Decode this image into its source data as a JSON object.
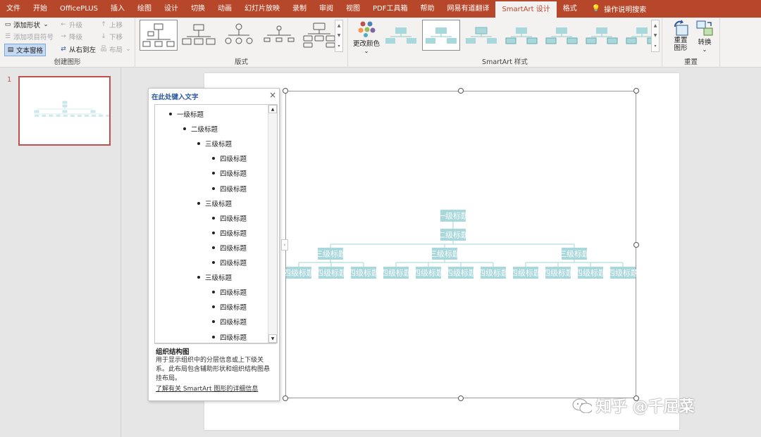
{
  "menubar": {
    "tabs": [
      "文件",
      "开始",
      "OfficePLUS",
      "插入",
      "绘图",
      "设计",
      "切换",
      "动画",
      "幻灯片放映",
      "录制",
      "审阅",
      "视图",
      "PDF工具箱",
      "帮助",
      "网易有道翻译",
      "SmartArt 设计",
      "格式"
    ],
    "active_tab": "SmartArt 设计",
    "tell_me": "操作说明搜索"
  },
  "ribbon": {
    "create_graphic": {
      "label": "创建图形",
      "add_shape": "添加形状",
      "add_bullet": "添加项目符号",
      "text_pane": "文本窗格",
      "promote": "升级",
      "demote": "降级",
      "right_to_left": "从右到左",
      "move_up": "上移",
      "move_down": "下移",
      "layout": "布局"
    },
    "layouts": {
      "label": "版式"
    },
    "styles": {
      "label": "SmartArt 样式",
      "change_colors": "更改颜色"
    },
    "reset": {
      "label": "重置",
      "reset_graphic": "重置图形",
      "convert": "转换"
    }
  },
  "thumbnails": {
    "slide_number": "1"
  },
  "text_pane": {
    "title": "在此处键入文字",
    "items": [
      {
        "level": 1,
        "text": "一级标题"
      },
      {
        "level": 2,
        "text": "二级标题"
      },
      {
        "level": 3,
        "text": "三级标题"
      },
      {
        "level": 4,
        "text": "四级标题"
      },
      {
        "level": 4,
        "text": "四级标题"
      },
      {
        "level": 4,
        "text": "四级标题"
      },
      {
        "level": 3,
        "text": "三级标题"
      },
      {
        "level": 4,
        "text": "四级标题"
      },
      {
        "level": 4,
        "text": "四级标题"
      },
      {
        "level": 4,
        "text": "四级标题"
      },
      {
        "level": 4,
        "text": "四级标题"
      },
      {
        "level": 3,
        "text": "三级标题"
      },
      {
        "level": 4,
        "text": "四级标题"
      },
      {
        "level": 4,
        "text": "四级标题"
      },
      {
        "level": 4,
        "text": "四级标题"
      },
      {
        "level": 4,
        "text": "四级标题"
      }
    ],
    "desc_title": "组织结构图",
    "desc": "用于显示组织中的分层信息或上下级关系。此布局包含辅助形状和组织结构图悬挂布局。",
    "link": "了解有关 SmartArt 图形的详细信息"
  },
  "smartart": {
    "top": "一级标题",
    "assistant": "二级标题",
    "level3": [
      "三级标题",
      "三级标题",
      "三级标题"
    ],
    "level4_groups": [
      [
        "四级标题",
        "四级标题",
        "四级标题"
      ],
      [
        "四级标题",
        "四级标题",
        "四级标题",
        "四级标题"
      ],
      [
        "四级标题",
        "四级标题",
        "四级标题",
        "四级标题"
      ]
    ],
    "fill_color": "#a8d8dc",
    "line_color": "#b0dde0"
  },
  "watermark": {
    "text": "知乎 @千屈菜"
  },
  "colors": {
    "accent": "#b7472a",
    "selection": "#c0504d"
  }
}
